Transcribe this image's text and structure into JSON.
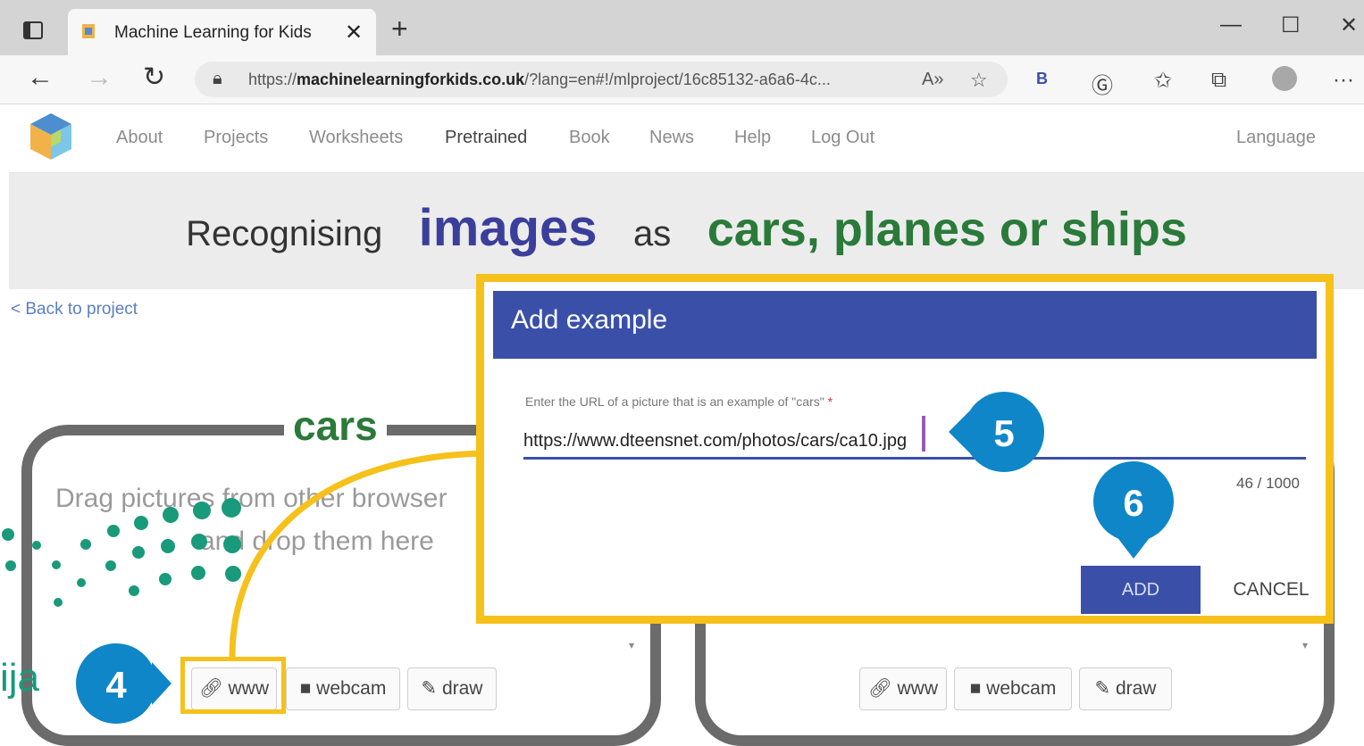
{
  "browser": {
    "tab_title": "Machine Learning for Kids",
    "tab_close": "✕",
    "new_tab": "+",
    "url_prefix": "https://",
    "url_host": "machinelearningforkids.co.uk",
    "url_rest": "/?lang=en#!/mlproject/16c85132-a6a6-4c...",
    "window_minimize": "—",
    "window_maximize": "☐",
    "window_close": "✕"
  },
  "site_nav": {
    "links": [
      "About",
      "Projects",
      "Worksheets",
      "Pretrained",
      "Book",
      "News",
      "Help",
      "Log Out"
    ],
    "language": "Language"
  },
  "banner": {
    "word1": "Recognising",
    "word2": "images",
    "word3": "as",
    "word4": "cars, planes or ships"
  },
  "back_link": "< Back to project",
  "bucket_cars": {
    "label": "cars",
    "drag_text_line1": "Drag pictures from other browser",
    "drag_text_line2": "and drop them here",
    "buttons": [
      "www",
      "webcam",
      "draw"
    ]
  },
  "bucket_right": {
    "buttons": [
      "www",
      "webcam",
      "draw"
    ]
  },
  "dialog": {
    "title": "Add example",
    "field_label": "Enter the URL of a picture that is an example of \"cars\"",
    "required_mark": "*",
    "url_value": "https://www.dteensnet.com/photos/cars/ca10.jpg",
    "counter": "46 / 1000",
    "add_label": "ADD",
    "cancel_label": "CANCEL"
  },
  "callouts": [
    "4",
    "5",
    "6"
  ],
  "brand_fragment": "ija",
  "colors": {
    "dialog_header": "#3a50a8",
    "highlight": "#f5c11a",
    "callout": "#0f86c8",
    "banner_green": "#2a7a3a",
    "banner_blue": "#3a3f9c"
  }
}
